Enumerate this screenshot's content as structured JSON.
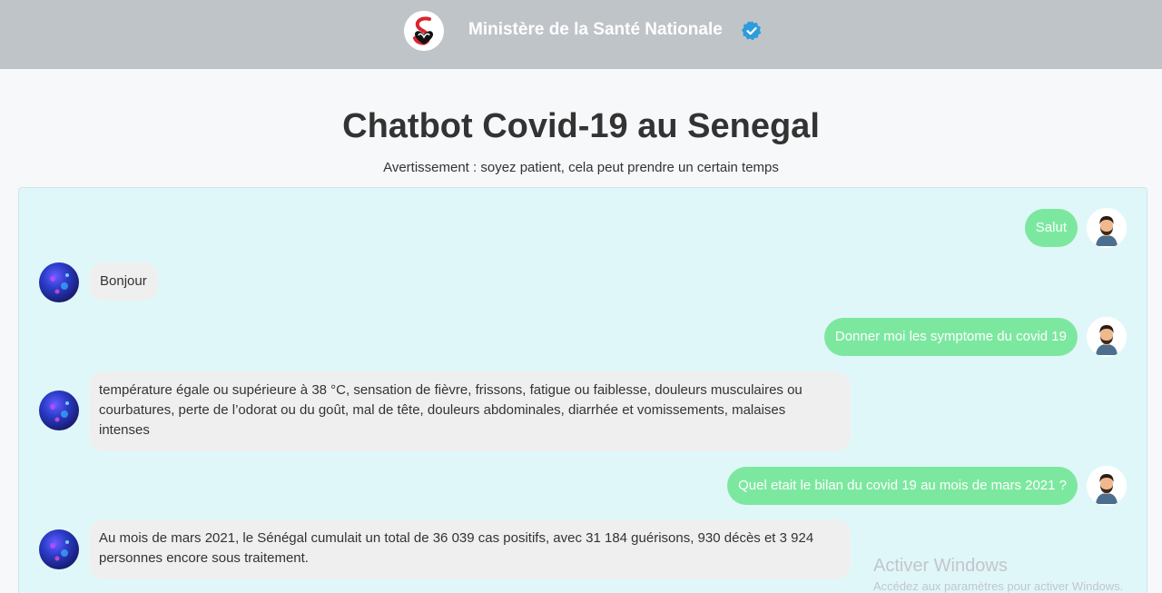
{
  "header": {
    "ministry_name": "Ministère de la Santé Nationale",
    "logo_icon": "ministry-logo-icon",
    "verified_icon": "verified-badge-icon",
    "bar_color": "#bfc4c9",
    "verified_color": "#2d9cdb"
  },
  "page": {
    "title": "Chatbot Covid-19 au Senegal",
    "subtitle": "Avertissement : soyez patient, cela peut prendre un certain temps"
  },
  "chat": {
    "background": "#e0f7f9",
    "user_bubble_color": "#7ce89f",
    "bot_bubble_color": "#efefef",
    "messages": [
      {
        "sender": "user",
        "text": "Salut"
      },
      {
        "sender": "bot",
        "text": "Bonjour"
      },
      {
        "sender": "user",
        "text": "Donner moi les symptome du covid 19"
      },
      {
        "sender": "bot",
        "text": "température égale ou supérieure à 38 °C, sensation de fièvre, frissons, fatigue ou faiblesse, douleurs musculaires ou courbatures, perte de l’odorat ou du goût, mal de tête, douleurs abdominales, diarrhée et vomissements, malaises intenses"
      },
      {
        "sender": "user",
        "text": "Quel etait le bilan du covid 19 au mois de mars 2021 ?"
      },
      {
        "sender": "bot",
        "text": "Au mois de mars 2021, le Sénégal cumulait un total de 36 039 cas positifs, avec 31 184 guérisons, 930 décès et 3 924 personnes encore sous traitement."
      }
    ]
  },
  "windows_watermark": {
    "title": "Activer Windows",
    "subtitle": "Accédez aux paramètres pour activer Windows."
  }
}
